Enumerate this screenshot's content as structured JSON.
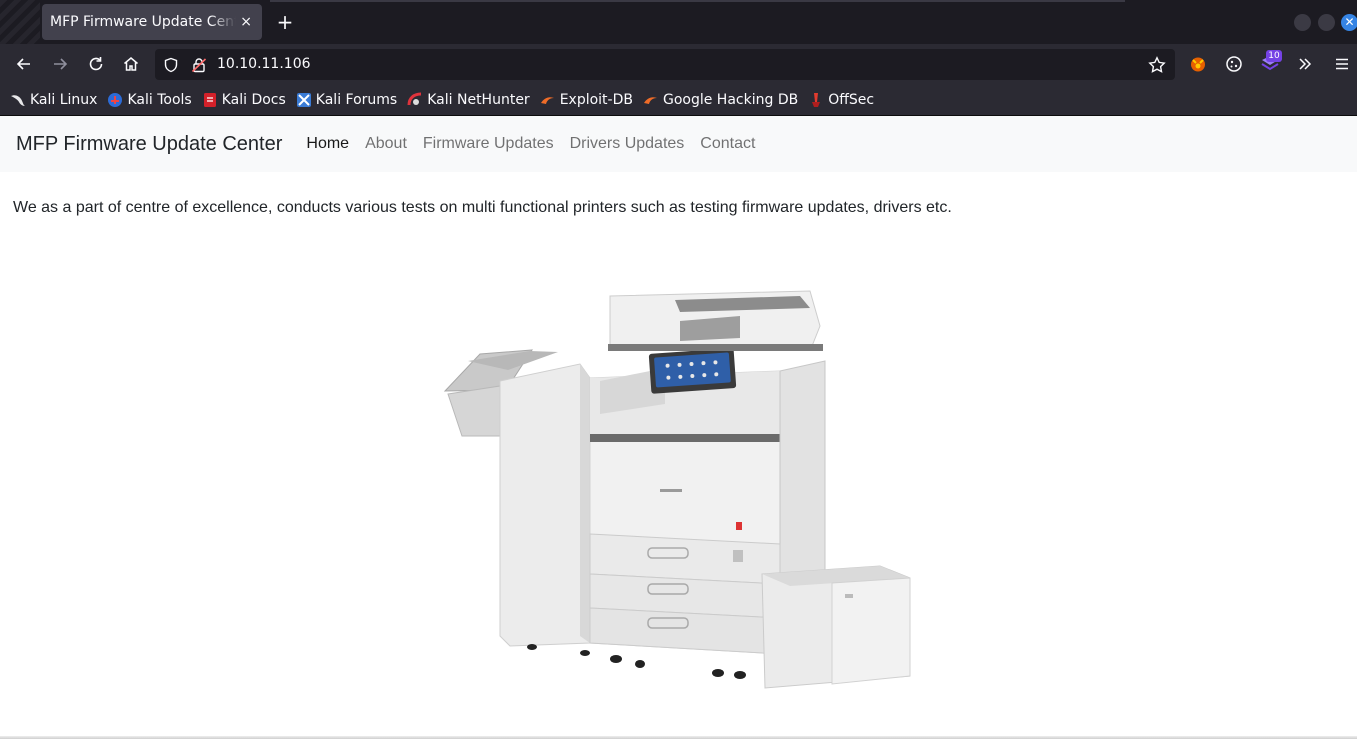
{
  "browser": {
    "tab_title": "MFP Firmware Update Center",
    "tab_close": "×",
    "new_tab": "+",
    "url": "10.10.11.106",
    "extension_badge": "10",
    "bookmarks": [
      {
        "label": "Kali Linux",
        "icon": "kali-dragon-icon"
      },
      {
        "label": "Kali Tools",
        "icon": "kali-tools-icon"
      },
      {
        "label": "Kali Docs",
        "icon": "kali-docs-icon"
      },
      {
        "label": "Kali Forums",
        "icon": "kali-forums-icon"
      },
      {
        "label": "Kali NetHunter",
        "icon": "nethunter-icon"
      },
      {
        "label": "Exploit-DB",
        "icon": "exploit-db-icon"
      },
      {
        "label": "Google Hacking DB",
        "icon": "ghdb-icon"
      },
      {
        "label": "OffSec",
        "icon": "offsec-icon"
      }
    ]
  },
  "site": {
    "brand": "MFP Firmware Update Center",
    "nav": [
      "Home",
      "About",
      "Firmware Updates",
      "Drivers Updates",
      "Contact"
    ],
    "active_nav": "Home",
    "intro": "We as a part of centre of excellence, conducts various tests on multi functional printers such as testing firmware updates, drivers etc.",
    "image": "printer-photo"
  },
  "colors": {
    "chrome_dark": "#1c1b22",
    "chrome_toolbar": "#2b2a33",
    "site_nav_bg": "#f8f9fa",
    "accent": "#3584e4"
  }
}
